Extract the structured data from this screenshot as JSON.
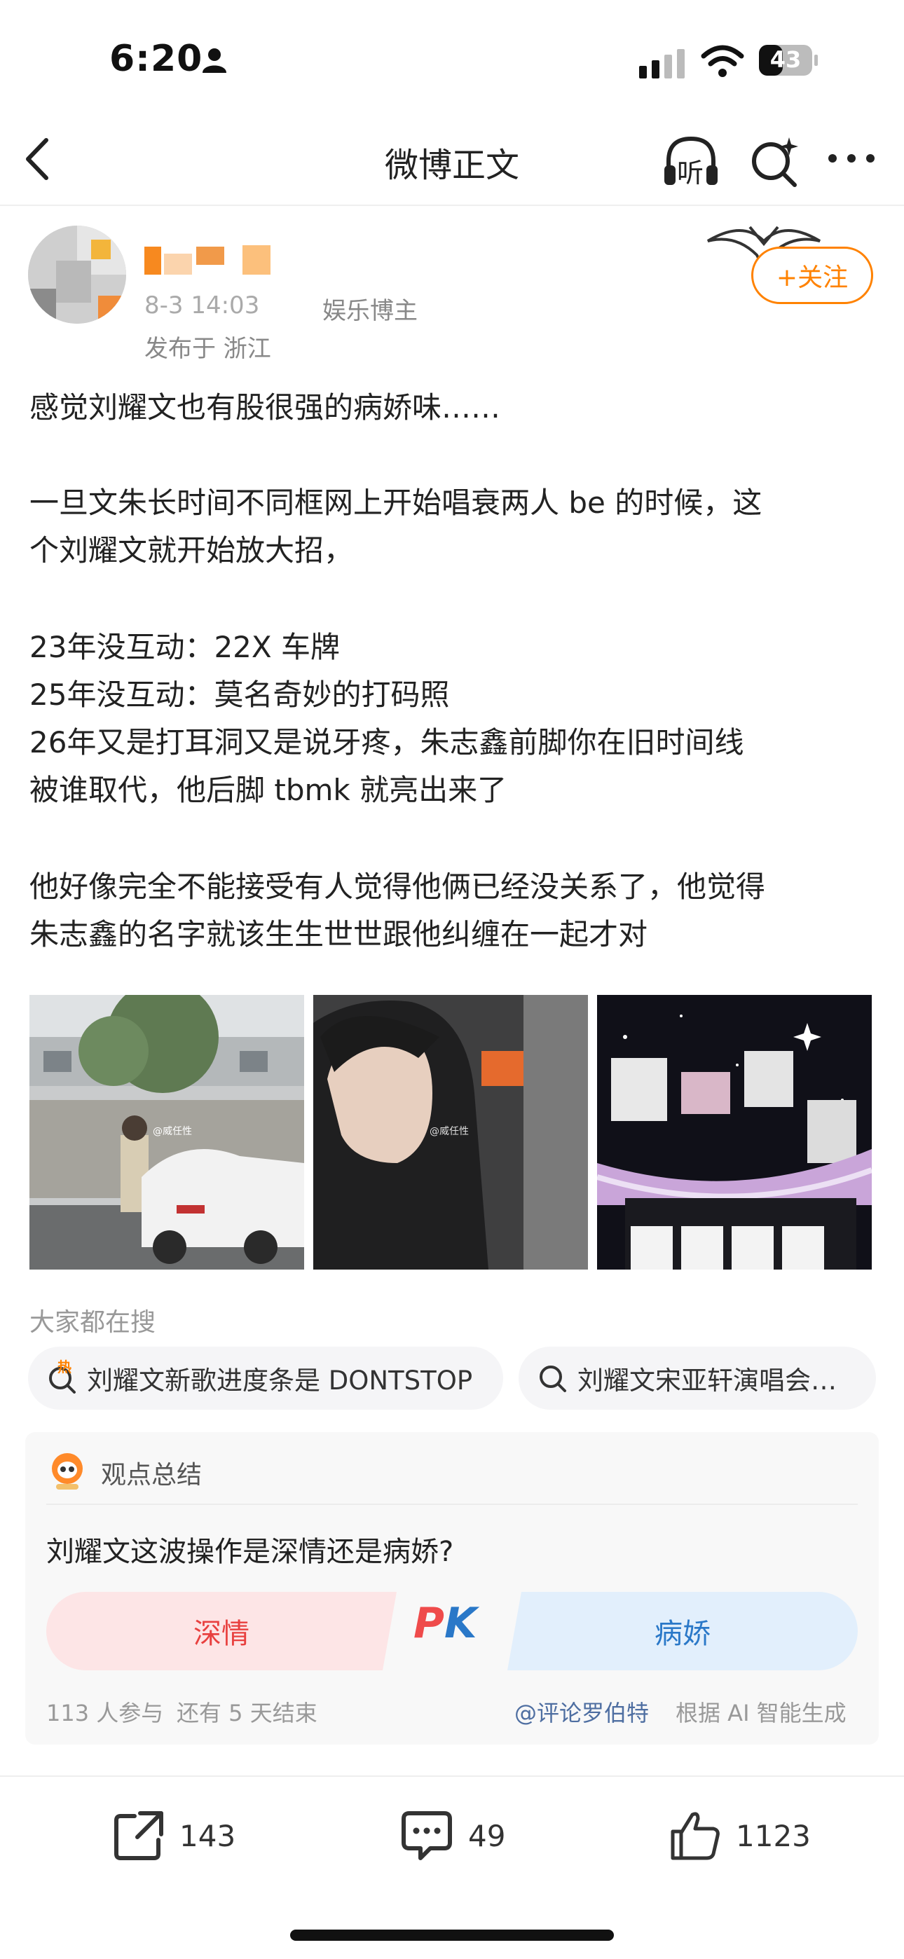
{
  "status_bar": {
    "time": "6:20",
    "battery": "43"
  },
  "nav": {
    "title": "微博正文",
    "listen_label": "听"
  },
  "author": {
    "time": "8-3 14:03",
    "role": "娱乐博主",
    "location": "发布于 浙江",
    "follow_label": "+关注"
  },
  "post": {
    "paragraphs": [
      "感觉刘耀文也有股很强的病娇味……",
      "一旦文朱长时间不同框网上开始唱衰两人 be 的时候，这",
      "个刘耀文就开始放大招，",
      "23年没互动：22X 车牌",
      "25年没互动：莫名奇妙的打码照",
      "26年又是打耳洞又是说牙疼，朱志鑫前脚你在旧时间线",
      "被谁取代，他后脚 tbmk 就亮出来了",
      "他好像完全不能接受有人觉得他俩已经没关系了，他觉得",
      "朱志鑫的名字就该生生世世跟他纠缠在一起才对"
    ],
    "watermark": "@威任性"
  },
  "search": {
    "heading": "大家都在搜",
    "items": [
      {
        "label": "刘耀文新歌进度条是 DONTSTOP",
        "hot_badge": "热"
      },
      {
        "label": "刘耀文宋亚轩演唱会…"
      }
    ]
  },
  "poll": {
    "title": "观点总结",
    "question": "刘耀文这波操作是深情还是病娇?",
    "left_option": "深情",
    "right_option": "病娇",
    "pk_label": "PK",
    "participants": "113 人参与",
    "ends": "还有 5 天结束",
    "source": "@评论罗伯特",
    "generated": "根据 AI 智能生成"
  },
  "actions": {
    "share_count": "143",
    "comment_count": "49",
    "like_count": "1123"
  },
  "colors": {
    "accent": "#ff8200",
    "pk_red": "#e8403f",
    "pk_blue": "#2a78c8"
  }
}
